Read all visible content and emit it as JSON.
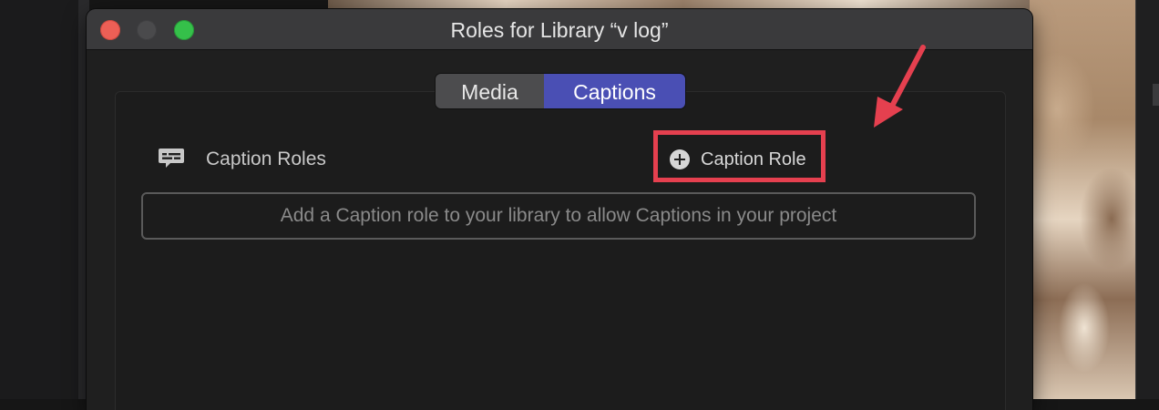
{
  "window": {
    "title": "Roles for Library “v log”"
  },
  "tabs": [
    {
      "label": "Media",
      "selected": false
    },
    {
      "label": "Captions",
      "selected": true
    }
  ],
  "caption_section": {
    "header_label": "Caption Roles",
    "header_icon": "caption-bubble-icon",
    "add_button_label": "Caption Role",
    "add_button_icon": "plus-circle-icon",
    "empty_hint": "Add a Caption role to your library to allow Captions in your project"
  },
  "colors": {
    "selected_tab": "#4a4fb4",
    "annotation": "#e5404f",
    "close": "#ec5f56",
    "zoom": "#35c04a"
  }
}
